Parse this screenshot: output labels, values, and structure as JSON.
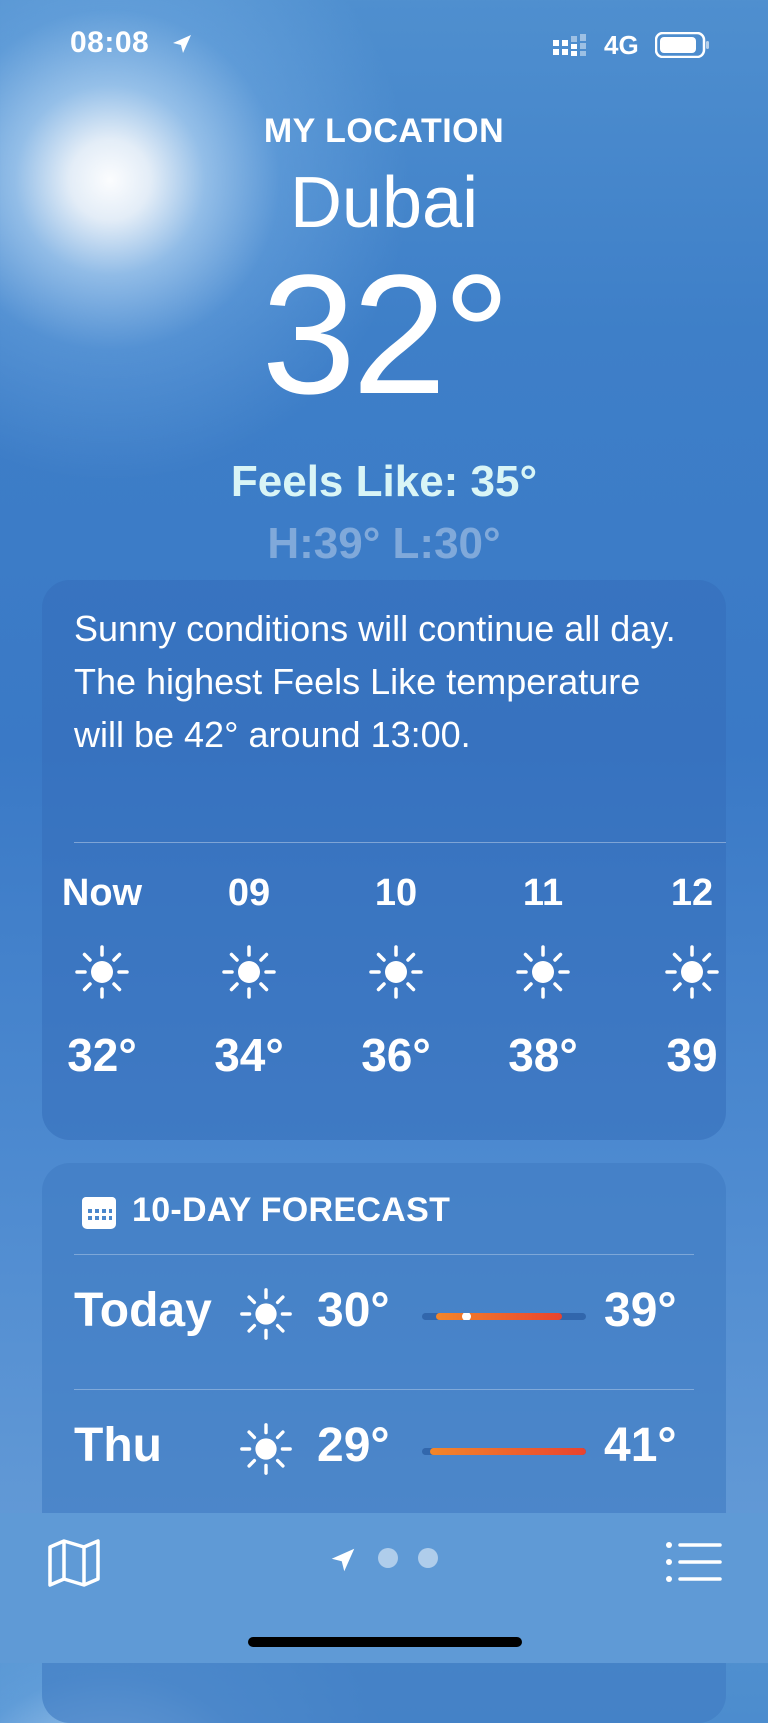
{
  "status_bar": {
    "time": "08:08",
    "network": "4G"
  },
  "header": {
    "label": "MY LOCATION",
    "city": "Dubai",
    "temperature": "32°",
    "feels_like": "Feels Like: 35°",
    "high_low": "H:39°  L:30°"
  },
  "hourly": {
    "summary": "Sunny conditions will continue all day. The highest Feels Like temperature will be 42° around 13:00.",
    "items": [
      {
        "label": "Now",
        "icon": "sun-icon",
        "temp": "32°"
      },
      {
        "label": "09",
        "icon": "sun-icon",
        "temp": "34°"
      },
      {
        "label": "10",
        "icon": "sun-icon",
        "temp": "36°"
      },
      {
        "label": "11",
        "icon": "sun-icon",
        "temp": "38°"
      },
      {
        "label": "12",
        "icon": "sun-icon",
        "temp": "39"
      }
    ]
  },
  "forecast": {
    "title": "10-DAY FORECAST",
    "days": [
      {
        "day": "Today",
        "icon": "sun-icon",
        "low": "30°",
        "high": "39°",
        "current_position": 0.27
      },
      {
        "day": "Thu",
        "icon": "sun-icon",
        "low": "29°",
        "high": "41°"
      }
    ]
  },
  "toolbar": {
    "page_count": 2
  },
  "colors": {
    "accent_warm": "#f3862a",
    "accent_hot": "#e9432f",
    "toolbar": "#5f9ad6"
  }
}
